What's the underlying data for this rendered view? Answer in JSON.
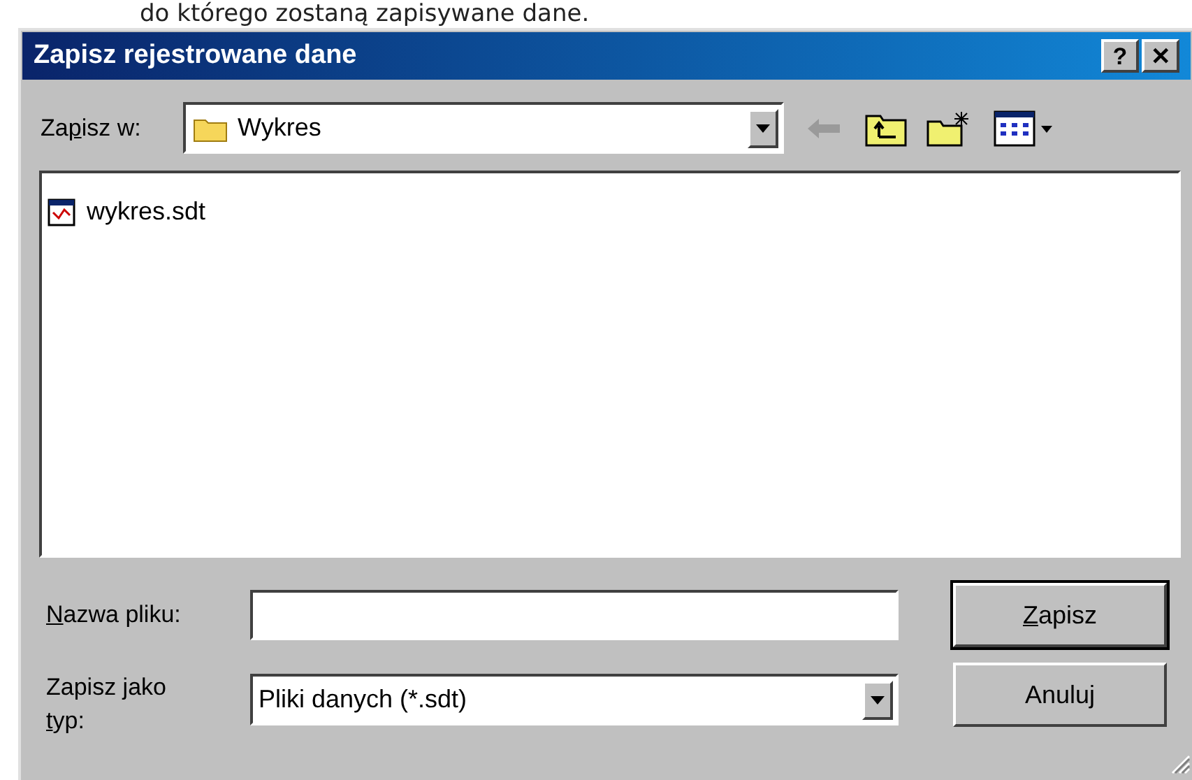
{
  "background_text": "do którego zostaną zapisywane dane.",
  "window": {
    "title": "Zapisz rejestrowane dane",
    "title_buttons": [
      "?",
      "✕"
    ]
  },
  "save_in": {
    "label": {
      "pre": "Za",
      "key": "p",
      "post": "isz w:"
    },
    "value": "Wykres"
  },
  "files": [
    {
      "name": "wykres.sdt",
      "selected": false
    }
  ],
  "file_name": {
    "label": {
      "key": "N",
      "post": "azwa pliku:"
    }
  },
  "file_type": {
    "label": {
      "pre": "Zapisz jako ",
      "key": "t",
      "post": "yp:"
    },
    "value": "Pliki danych (*.sdt)"
  },
  "buttons": [
    {
      "label": {
        "key": "Z",
        "post": "apisz"
      },
      "default": true
    },
    {
      "label": {
        "pre": "Anuluj"
      },
      "default": false
    }
  ]
}
